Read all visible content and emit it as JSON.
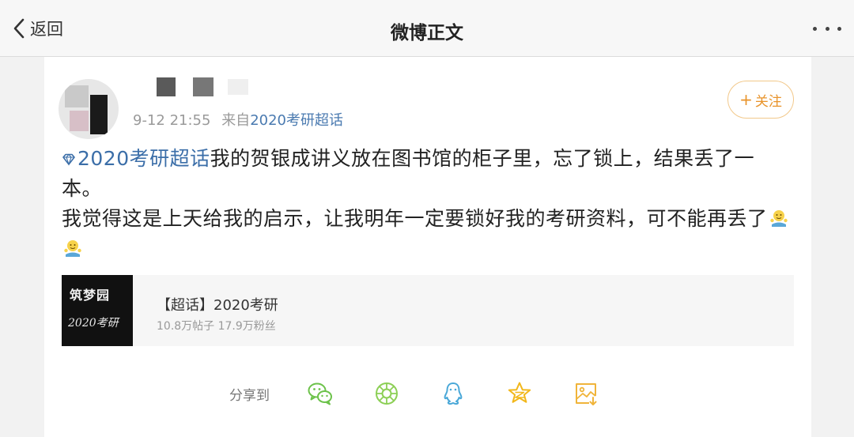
{
  "nav": {
    "back_label": "返回",
    "title": "微博正文"
  },
  "post": {
    "time": "9-12 21:55",
    "source_prefix": "来自",
    "source_link": "2020考研超话",
    "follow_label": "关注",
    "follow_plus": "+",
    "tag": "2020考研超话",
    "text_line1": "我的贺银成讲义放在图书馆的柜子里，忘了锁上，结果丢了一本。",
    "text_line2": "我觉得这是上天给我的启示，让我明年一定要锁好我的考研资料，可不能再丢了"
  },
  "topic": {
    "image_line1": "筑梦园",
    "image_line2": "2020考研",
    "title": "【超话】2020考研",
    "stats": "10.8万帖子 17.9万粉丝"
  },
  "share": {
    "label": "分享到",
    "targets": [
      "wechat-icon",
      "moments-icon",
      "qq-icon",
      "qzone-icon",
      "save-image-icon"
    ]
  },
  "colors": {
    "link": "#3b6ea8",
    "follow": "#e8932a",
    "share_green": "#6cc24a",
    "share_blue": "#4aa8d8",
    "share_yellow": "#f2b71a"
  }
}
